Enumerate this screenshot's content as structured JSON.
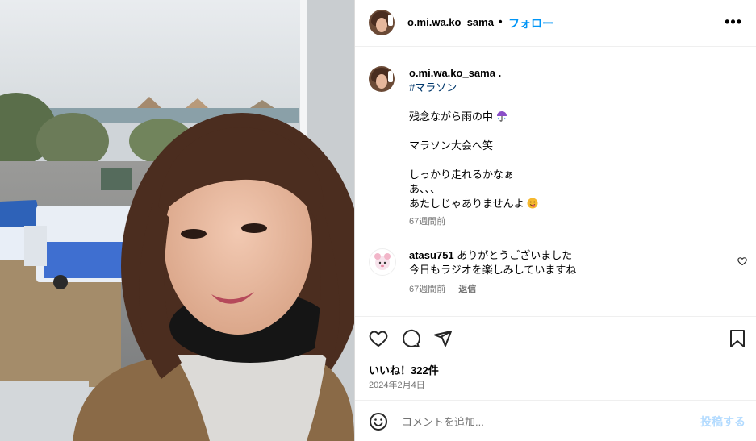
{
  "post": {
    "author": "o.mi.wa.ko_sama",
    "dot": "•",
    "follow_label": "フォロー",
    "more_label": "•••"
  },
  "caption": {
    "author": "o.mi.wa.ko_sama",
    "trailing": ".",
    "hashtag": "#マラソン",
    "line1": "残念ながら雨の中",
    "line1_emoji": "umbrella-rain-icon",
    "line2": "マラソン大会へ笑",
    "line3": "しっかり走れるかなぁ",
    "line4": "あ、、、",
    "line5": "あたしじゃありませんよ",
    "line5_emoji": "tongue-face-icon",
    "time": "67週間前"
  },
  "comment": {
    "author": "atasu751",
    "text_line1": "ありがとうございました",
    "text_line2": "今日もラジオを楽しみしていますね",
    "time": "67週間前",
    "reply_label": "返信"
  },
  "actions": {
    "like_icon": "heart-outline-icon",
    "comment_icon": "comment-bubble-icon",
    "share_icon": "paper-plane-icon",
    "save_icon": "bookmark-icon"
  },
  "likes_text": "いいね！322件",
  "date_text": "2024年2月4日",
  "compose": {
    "placeholder": "コメントを追加...",
    "post_label": "投稿する"
  },
  "colors": {
    "accent": "#0095f6",
    "hashtag": "#00376b",
    "muted": "#737373",
    "post_disabled": "#b3dbff"
  }
}
